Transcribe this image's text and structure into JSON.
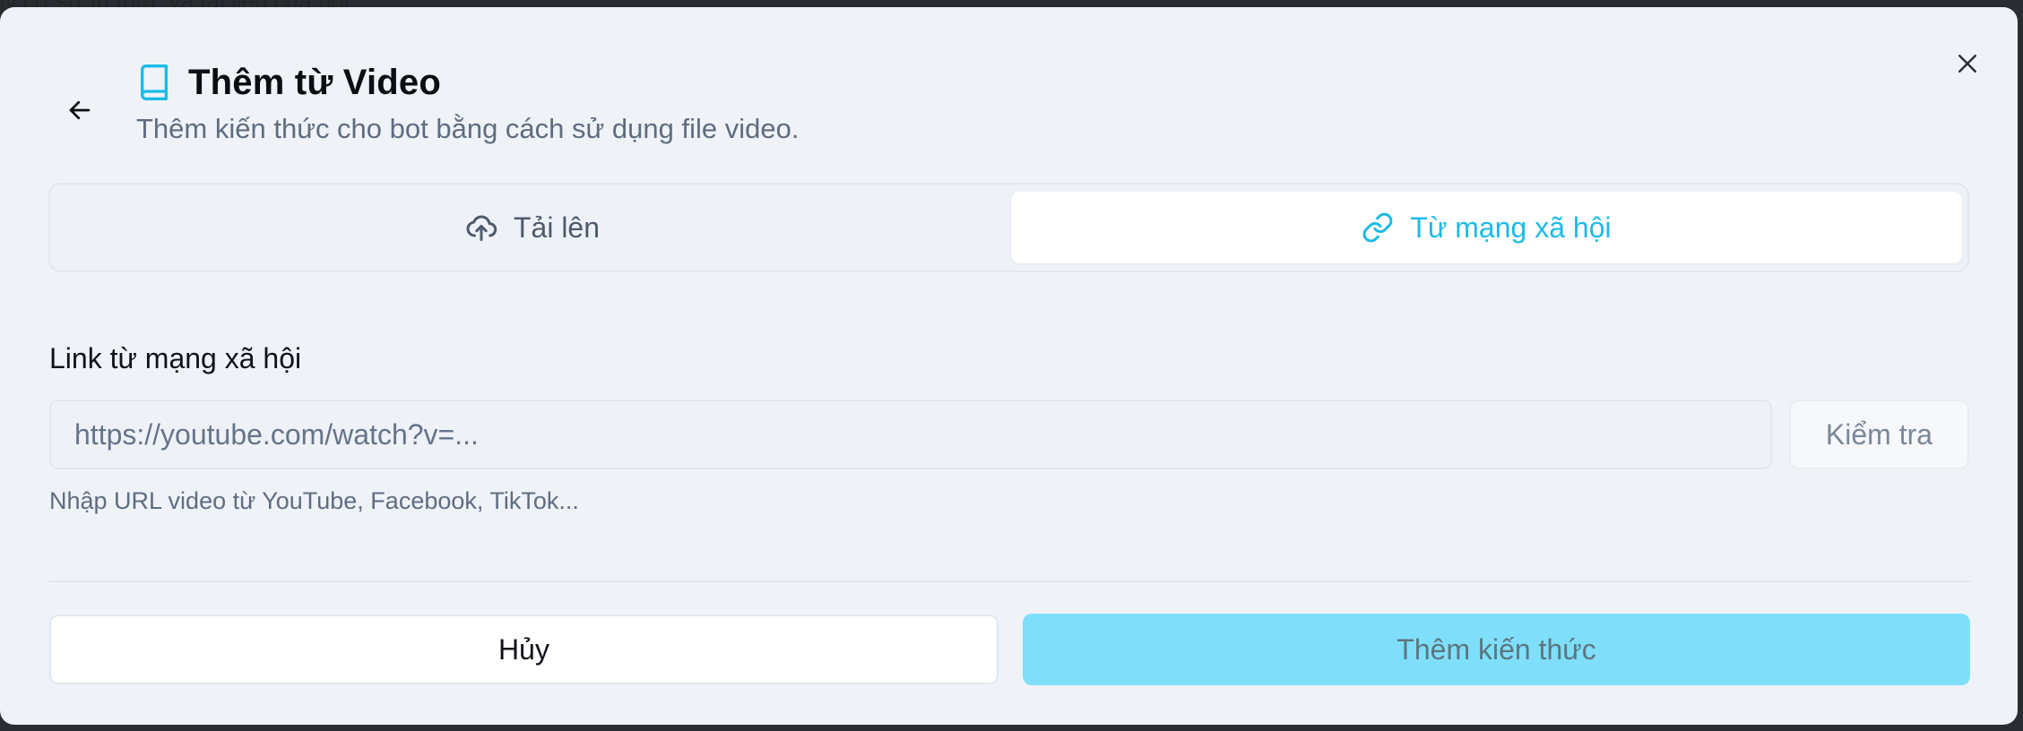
{
  "backdrop": {
    "text": "ly cơ sở tri thức và tài liệu của bot"
  },
  "dialog": {
    "title": "Thêm từ Video",
    "subtitle": "Thêm kiến thức cho bot bằng cách sử dụng file video.",
    "title_icon": "book-icon",
    "back_icon": "arrow-left-icon",
    "close_icon": "close-icon"
  },
  "tabs": [
    {
      "label": "Tải lên",
      "icon": "cloud-upload-icon",
      "active": false
    },
    {
      "label": "Từ mạng xã hội",
      "icon": "link-icon",
      "active": true
    }
  ],
  "form": {
    "label": "Link từ mạng xã hội",
    "placeholder": "https://youtube.com/watch?v=...",
    "value": "",
    "check_label": "Kiểm tra",
    "hint": "Nhập URL video từ YouTube, Facebook, TikTok..."
  },
  "footer": {
    "cancel_label": "Hủy",
    "submit_label": "Thêm kiến thức"
  },
  "colors": {
    "accent": "#1bbbe7",
    "submit_bg": "#7fdffa",
    "modal_bg": "#eff3f8"
  }
}
